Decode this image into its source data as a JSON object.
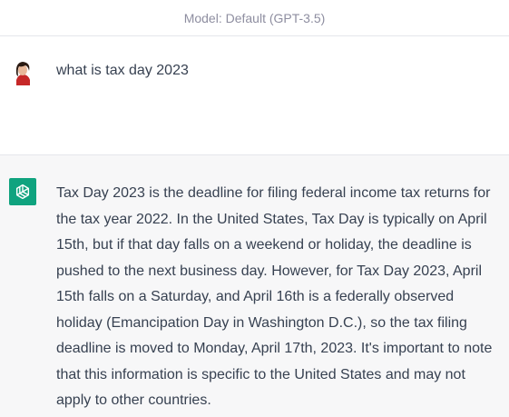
{
  "header": {
    "model_label": "Model: Default (GPT-3.5)"
  },
  "conversation": {
    "user": {
      "avatar": "user-photo-avatar",
      "text": "what is tax day 2023"
    },
    "assistant": {
      "avatar": "openai-logo-icon",
      "text": "Tax Day 2023 is the deadline for filing federal income tax returns for the tax year 2022. In the United States, Tax Day is typically on April 15th, but if that day falls on a weekend or holiday, the deadline is pushed to the next business day. However, for Tax Day 2023, April 15th falls on a Saturday, and April 16th is a federally observed holiday (Emancipation Day in Washington D.C.), so the tax filing deadline is moved to Monday, April 17th, 2023. It's important to note that this information is specific to the United States and may not apply to other countries."
    }
  },
  "colors": {
    "assistant_avatar_bg": "#10a37f",
    "assistant_row_bg": "#f7f7f8",
    "text": "#374151",
    "muted": "#8e8ea0"
  }
}
